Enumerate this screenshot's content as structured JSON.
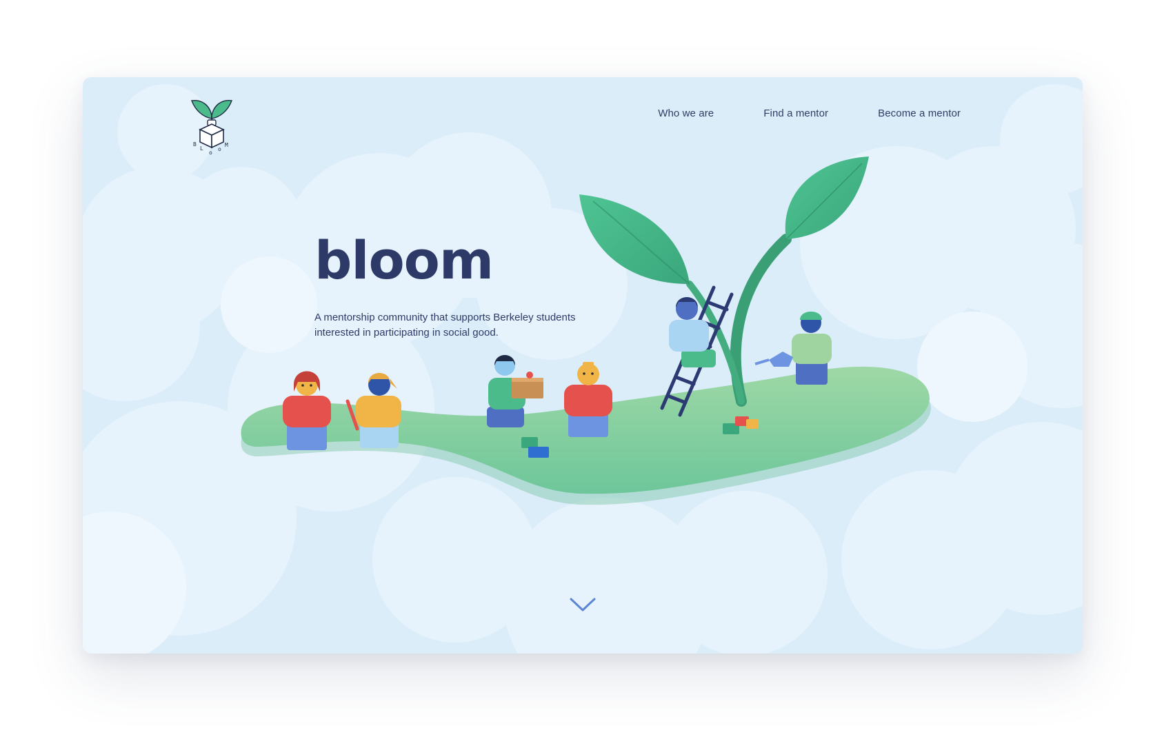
{
  "brand": {
    "logo_letters": [
      "B",
      "L",
      "o",
      "o",
      "M"
    ],
    "title": "bloom",
    "tagline_line1": "A mentorship community that supports Berkeley students",
    "tagline_line2": "interested in participating in social good."
  },
  "nav": {
    "items": [
      {
        "label": "Who we are"
      },
      {
        "label": "Find a mentor"
      },
      {
        "label": "Become a mentor"
      }
    ]
  },
  "icons": {
    "logo": "bloom-sprout-cube-icon",
    "scroll": "chevron-down-icon"
  },
  "colors": {
    "background": "#dcedfa",
    "cloud": "#e7f3fc",
    "text": "#2d3a68",
    "leaf": "#4cbb8b",
    "island": "#86cf98",
    "chevron": "#5b86d6"
  }
}
